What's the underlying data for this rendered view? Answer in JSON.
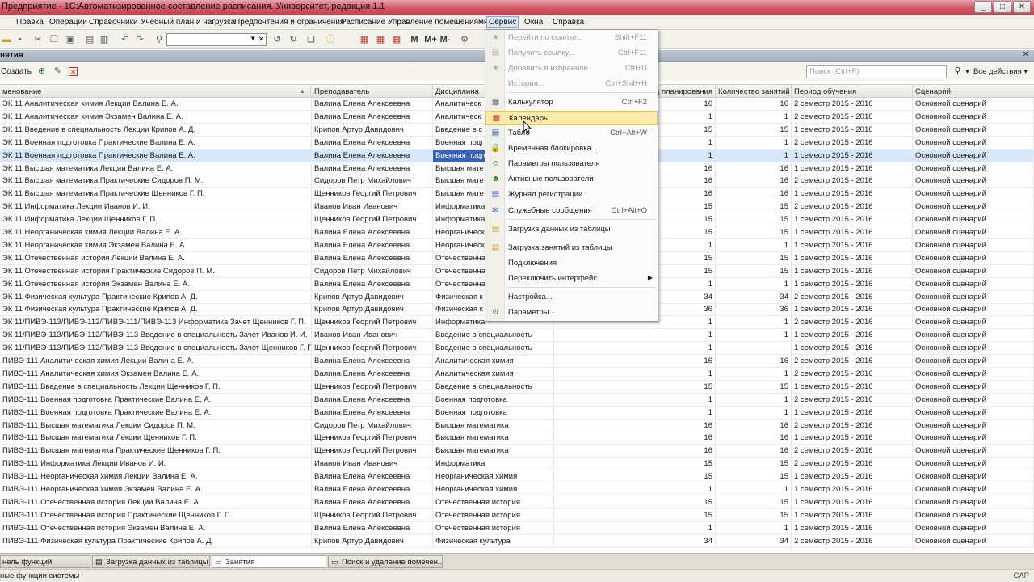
{
  "window": {
    "title": "Предприятие - 1С:Автоматизированное составление расписания. Университет, редакция 1.1",
    "buttons": [
      "_",
      "□",
      "✕"
    ]
  },
  "menubar": {
    "items": [
      "Правка",
      "Операции",
      "Справочники",
      "Учебный план и нагрузка",
      "Предпочтения и ограничения",
      "Расписание",
      "Управление помещениями",
      "Сервис",
      "Окна",
      "Справка"
    ]
  },
  "toolbar": {
    "icons": [
      "folder-icon",
      "save-icon",
      "cut-icon",
      "copy-icon",
      "paste-icon",
      "print-icon",
      "preview-icon",
      "undo-icon",
      "redo-icon",
      "find-icon",
      "prev-icon",
      "next-icon",
      "refresh-icon",
      "info-icon",
      "table-icon",
      "calculator-icon",
      "calendar-icon",
      "font-icon",
      "font-plus-icon",
      "font-minus-icon",
      "settings-icon"
    ],
    "search_value": "",
    "m_labels": [
      "M",
      "M+",
      "M-"
    ]
  },
  "form": {
    "title": "нятия",
    "close": "✕",
    "create_label": "Создать",
    "search_placeholder": "Поиск (Ctrl+F)",
    "all_actions": "Все действия"
  },
  "table": {
    "columns": [
      "менование",
      "Преподаватель",
      "Дисциплина",
      "од планирования",
      "Количество занятий",
      "Период обучения",
      "Сценарий"
    ],
    "rows": [
      [
        "ЭК 11 Аналитическая химия Лекции Валина Е. А.",
        "Валина Елена Алексеевна",
        "Аналитическ",
        "16",
        "16",
        "2 семестр 2015 - 2016",
        "Основной сценарий"
      ],
      [
        "ЭК 11 Аналитическая химия Экзамен Валина Е. А.",
        "Валина Елена Алексеевна",
        "Аналитическ",
        "1",
        "1",
        "2 семестр 2015 - 2016",
        "Основной сценарий"
      ],
      [
        "ЭК 11 Введение в специальность Лекции Крипов А. Д.",
        "Крипов Артур Давидович",
        "Введение в с",
        "15",
        "15",
        "1 семестр 2015 - 2016",
        "Основной сценарий"
      ],
      [
        "ЭК 11 Военная подготовка Практические Валина Е. А.",
        "Валина Елена Алексеевна",
        "Военная подг",
        "1",
        "1",
        "2 семестр 2015 - 2016",
        "Основной сценарий"
      ],
      [
        "ЭК 11 Военная подготовка Практические Валина Е. А.",
        "Валина Елена Алексеевна",
        "Военная подго",
        "1",
        "1",
        "1 семестр 2015 - 2016",
        "Основной сценарий"
      ],
      [
        "ЭК 11 Высшая математика Лекции Валина Е. А.",
        "Валина Елена Алексеевна",
        "Высшая мате",
        "16",
        "16",
        "1 семестр 2015 - 2016",
        "Основной сценарий"
      ],
      [
        "ЭК 11 Высшая математика Практические Сидоров П. М.",
        "Сидоров Петр Михайлович",
        "Высшая мате",
        "16",
        "16",
        "2 семестр 2015 - 2016",
        "Основной сценарий"
      ],
      [
        "ЭК 11 Высшая математика Практические Щенников Г. П.",
        "Щенников Георгий Петрович",
        "Высшая мате",
        "16",
        "16",
        "1 семестр 2015 - 2016",
        "Основной сценарий"
      ],
      [
        "ЭК 11 Информатика Лекции Иванов И. И.",
        "Иванов Иван Иванович",
        "Информатика",
        "15",
        "15",
        "2 семестр 2015 - 2016",
        "Основной сценарий"
      ],
      [
        "ЭК 11 Информатика Лекции Щенников Г. П.",
        "Щенников Георгий Петрович",
        "Информатика",
        "15",
        "15",
        "1 семестр 2015 - 2016",
        "Основной сценарий"
      ],
      [
        "ЭК 11 Неорганическая химия Лекции Валина Е. А.",
        "Валина Елена Алексеевна",
        "Неорганическ",
        "15",
        "15",
        "1 семестр 2015 - 2016",
        "Основной сценарий"
      ],
      [
        "ЭК 11 Неорганическая химия Экзамен Валина Е. А.",
        "Валина Елена Алексеевна",
        "Неорганическ",
        "1",
        "1",
        "1 семестр 2015 - 2016",
        "Основной сценарий"
      ],
      [
        "ЭК 11 Отечественная история Лекции Валина Е. А.",
        "Валина Елена Алексеевна",
        "Отечественна",
        "15",
        "15",
        "1 семестр 2015 - 2016",
        "Основной сценарий"
      ],
      [
        "ЭК 11 Отечественная история Практические Сидоров П. М.",
        "Сидоров Петр Михайлович",
        "Отечественна",
        "15",
        "15",
        "1 семестр 2015 - 2016",
        "Основной сценарий"
      ],
      [
        "ЭК 11 Отечественная история Экзамен Валина Е. А.",
        "Валина Елена Алексеевна",
        "Отечественна",
        "1",
        "1",
        "1 семестр 2015 - 2016",
        "Основной сценарий"
      ],
      [
        "ЭК 11 Физическая культура Практические Крипов А. Д.",
        "Крипов Артур Давидович",
        "Физическая к",
        "34",
        "34",
        "2 семестр 2015 - 2016",
        "Основной сценарий"
      ],
      [
        "ЭК 11 Физическая культура Практические Крипов А. Д.",
        "Крипов Артур Давидович",
        "Физическая к",
        "36",
        "36",
        "1 семестр 2015 - 2016",
        "Основной сценарий"
      ],
      [
        "ЭК 11/ПИВЭ-113/ПИВЭ-112/ПИВЭ-111/ПИВЭ-113 Информатика Зачет Щенников Г. П.",
        "Щенников Георгий Петрович",
        "Информатика",
        "1",
        "1",
        "2 семестр 2015 - 2016",
        "Основной сценарий"
      ],
      [
        "ЭК 11/ПИВЭ-113/ПИВЭ-112/ПИВЭ-113 Введение в специальность Зачет Иванов И. И.",
        "Иванов Иван Иванович",
        "Введение в специальность",
        "1",
        "1",
        "1 семестр 2015 - 2016",
        "Основной сценарий"
      ],
      [
        "ЭК 11/ПИВЭ-113/ПИВЭ-112/ПИВЭ-113 Введение в специальность Зачет Щенников Г. П.",
        "Щенников Георгий Петрович",
        "Введение в специальность",
        "1",
        "",
        "1 семестр 2015 - 2016",
        "Основной сценарий"
      ],
      [
        "ПИВЭ-111 Аналитическая химия Лекции Валина Е. А.",
        "Валина Елена Алексеевна",
        "Аналитическая химия",
        "16",
        "16",
        "2 семестр 2015 - 2016",
        "Основной сценарий"
      ],
      [
        "ПИВЭ-111 Аналитическая химия Экзамен Валина Е. А.",
        "Валина Елена Алексеевна",
        "Аналитическая химия",
        "1",
        "1",
        "2 семестр 2015 - 2016",
        "Основной сценарий"
      ],
      [
        "ПИВЭ-111 Введение в специальность Лекции Щенников Г. П.",
        "Щенников Георгий Петрович",
        "Введение в специальность",
        "15",
        "15",
        "1 семестр 2015 - 2016",
        "Основной сценарий"
      ],
      [
        "ПИВЭ-111 Военная подготовка Практические Валина Е. А.",
        "Валина Елена Алексеевна",
        "Военная подготовка",
        "1",
        "1",
        "2 семестр 2015 - 2016",
        "Основной сценарий"
      ],
      [
        "ПИВЭ-111 Военная подготовка Практические Валина Е. А.",
        "Валина Елена Алексеевна",
        "Военная подготовка",
        "1",
        "1",
        "1 семестр 2015 - 2016",
        "Основной сценарий"
      ],
      [
        "ПИВЭ-111 Высшая математика Лекции Сидоров П. М.",
        "Сидоров Петр Михайлович",
        "Высшая математика",
        "16",
        "16",
        "2 семестр 2015 - 2016",
        "Основной сценарий"
      ],
      [
        "ПИВЭ-111 Высшая математика Лекции Щенников Г. П.",
        "Щенников Георгий Петрович",
        "Высшая математика",
        "16",
        "16",
        "1 семестр 2015 - 2016",
        "Основной сценарий"
      ],
      [
        "ПИВЭ-111 Высшая математика Практические Щенников Г. П.",
        "Щенников Георгий Петрович",
        "Высшая математика",
        "16",
        "16",
        "2 семестр 2015 - 2016",
        "Основной сценарий"
      ],
      [
        "ПИВЭ-111 Информатика Лекции Иванов И. И.",
        "Иванов Иван Иванович",
        "Информатика",
        "15",
        "15",
        "2 семестр 2015 - 2016",
        "Основной сценарий"
      ],
      [
        "ПИВЭ-111 Неорганическая химия Лекции Валина Е. А.",
        "Валина Елена Алексеевна",
        "Неорганическая химия",
        "15",
        "15",
        "1 семестр 2015 - 2016",
        "Основной сценарий"
      ],
      [
        "ПИВЭ-111 Неорганическая химия Экзамен Валина Е. А.",
        "Валина Елена Алексеевна",
        "Неорганическая химия",
        "1",
        "1",
        "1 семестр 2015 - 2016",
        "Основной сценарий"
      ],
      [
        "ПИВЭ-111 Отечественная история Лекции Валина Е. А.",
        "Валина Елена Алексеевна",
        "Отечественная история",
        "15",
        "15",
        "1 семестр 2015 - 2016",
        "Основной сценарий"
      ],
      [
        "ПИВЭ-111 Отечественная история Практические Щенников Г. П.",
        "Щенников Георгий Петрович",
        "Отечественная история",
        "15",
        "15",
        "1 семестр 2015 - 2016",
        "Основной сценарий"
      ],
      [
        "ПИВЭ-111 Отечественная история Экзамен Валина Е. А.",
        "Валина Елена Алексеевна",
        "Отечественная история",
        "1",
        "1",
        "1 семестр 2015 - 2016",
        "Основной сценарий"
      ],
      [
        "ПИВЭ-111 Физическая культура Практические Крипов А. Д.",
        "Крипов Артур Давидович",
        "Физическая культура",
        "34",
        "34",
        "2 семестр 2015 - 2016",
        "Основной сценарий"
      ]
    ],
    "selected_row": 4
  },
  "service_menu": {
    "items": [
      {
        "label": "Перейти по ссылке...",
        "shortcut": "Shift+F11",
        "icon": "star-link-icon",
        "disabled": true
      },
      {
        "label": "Получить ссылку...",
        "shortcut": "Ctrl+F11",
        "icon": "link-icon",
        "disabled": true
      },
      {
        "label": "Добавить в избранное",
        "shortcut": "Ctrl+D",
        "icon": "star-icon",
        "disabled": true
      },
      {
        "label": "История...",
        "shortcut": "Ctrl+Shift+H",
        "icon": "history-icon",
        "disabled": true
      },
      {
        "label": "Калькулятор",
        "shortcut": "Ctrl+F2",
        "icon": "calculator-icon",
        "disabled": false
      },
      {
        "label": "Календарь",
        "shortcut": "",
        "icon": "calendar-icon",
        "disabled": false,
        "hover": true
      },
      {
        "label": "Табло",
        "shortcut": "Ctrl+Alt+W",
        "icon": "board-icon",
        "disabled": false
      },
      {
        "label": "Временная блокировка...",
        "shortcut": "",
        "icon": "lock-icon",
        "disabled": false
      },
      {
        "label": "Параметры пользователя",
        "shortcut": "",
        "icon": "user-settings-icon",
        "disabled": false
      },
      {
        "label": "Активные пользователи",
        "shortcut": "",
        "icon": "users-icon",
        "disabled": false
      },
      {
        "label": "Журнал регистрации",
        "shortcut": "",
        "icon": "log-icon",
        "disabled": false
      },
      {
        "label": "Служебные сообщения",
        "shortcut": "Ctrl+Alt+O",
        "icon": "message-icon",
        "disabled": false
      },
      {
        "label": "Загрузка данных из таблицы",
        "shortcut": "",
        "icon": "import-table-icon",
        "disabled": false
      },
      {
        "label": "Загрузка занятий из таблицы",
        "shortcut": "",
        "icon": "import-lessons-icon",
        "disabled": false
      },
      {
        "label": "Подключения",
        "shortcut": "",
        "icon": "",
        "disabled": false
      },
      {
        "label": "Переключить интерфейс",
        "shortcut": "",
        "icon": "",
        "disabled": false,
        "submenu": true
      },
      {
        "label": "Настройка...",
        "shortcut": "",
        "icon": "",
        "disabled": false
      },
      {
        "label": "Параметры...",
        "shortcut": "",
        "icon": "options-icon",
        "disabled": false
      }
    ]
  },
  "taskbar": {
    "tabs": [
      {
        "label": "нель функций",
        "active": false
      },
      {
        "label": "Загрузка данных из таблицы",
        "active": false
      },
      {
        "label": "Занятия",
        "active": true
      },
      {
        "label": "Поиск и удаление помечен...",
        "active": false
      }
    ]
  },
  "status": {
    "text": "ные функции системы",
    "cap": "CAP"
  },
  "colors": {
    "title_bar": "#d35b69",
    "selected_row": "#d7e6f8",
    "highlight_cell": "#3a62b4",
    "menu_hover": "#fde9a9"
  }
}
